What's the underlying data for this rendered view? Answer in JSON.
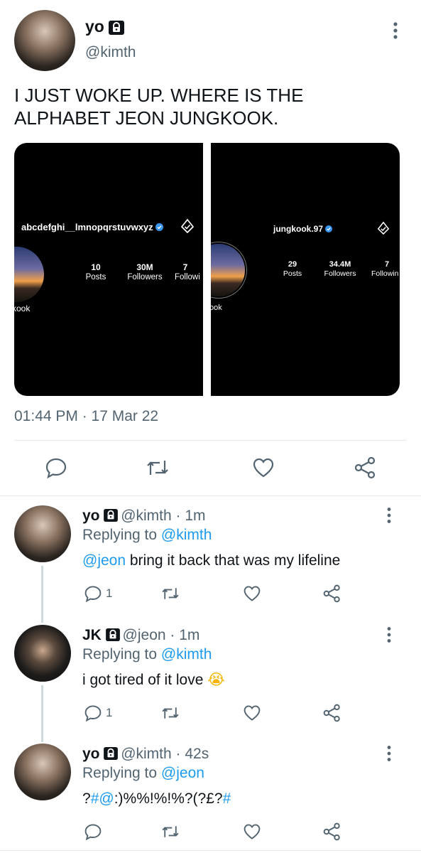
{
  "main_tweet": {
    "display_name": "yo",
    "handle": "@kimth",
    "text_line1": "I JUST WOKE UP. WHERE IS THE",
    "text_line2": "ALPHABET JEON JUNGKOOK.",
    "timestamp": "01:44 PM · 17 Mar 22",
    "media": [
      {
        "username": "abcdefghi__lmnopqrstuvwxyz",
        "stats": [
          {
            "value": "10",
            "label": "Posts"
          },
          {
            "value": "30M",
            "label": "Followers"
          },
          {
            "value": "7",
            "label": "Followi"
          }
        ],
        "partial_name": "kook"
      },
      {
        "username": "jungkook.97",
        "stats": [
          {
            "value": "29",
            "label": "Posts"
          },
          {
            "value": "34.4M",
            "label": "Followers"
          },
          {
            "value": "7",
            "label": "Followin"
          }
        ],
        "partial_name": "ook"
      }
    ]
  },
  "replies": [
    {
      "display_name": "yo",
      "handle": "@kimth",
      "time": "· 1m",
      "replying_to_prefix": "Replying to ",
      "replying_to": "@kimth",
      "mention": "@jeon",
      "text": " bring it back that was my lifeline",
      "reply_count": "1"
    },
    {
      "display_name": "JK",
      "handle": "@jeon",
      "time": "· 1m",
      "replying_to_prefix": "Replying to ",
      "replying_to": "@kimth",
      "text": "i got tired of it love",
      "emoji": "😭",
      "reply_count": "1"
    },
    {
      "display_name": "yo",
      "handle": "@kimth",
      "time": "· 42s",
      "replying_to_prefix": "Replying to ",
      "replying_to": "@jeon",
      "text_part1": "?",
      "text_hash1": "#@",
      "text_part2": ":)%%!%!%?(?£?",
      "text_hash2": "#"
    }
  ],
  "colors": {
    "accent": "#1d9bf0",
    "secondary_text": "#536471",
    "verified": "#3897f0"
  }
}
